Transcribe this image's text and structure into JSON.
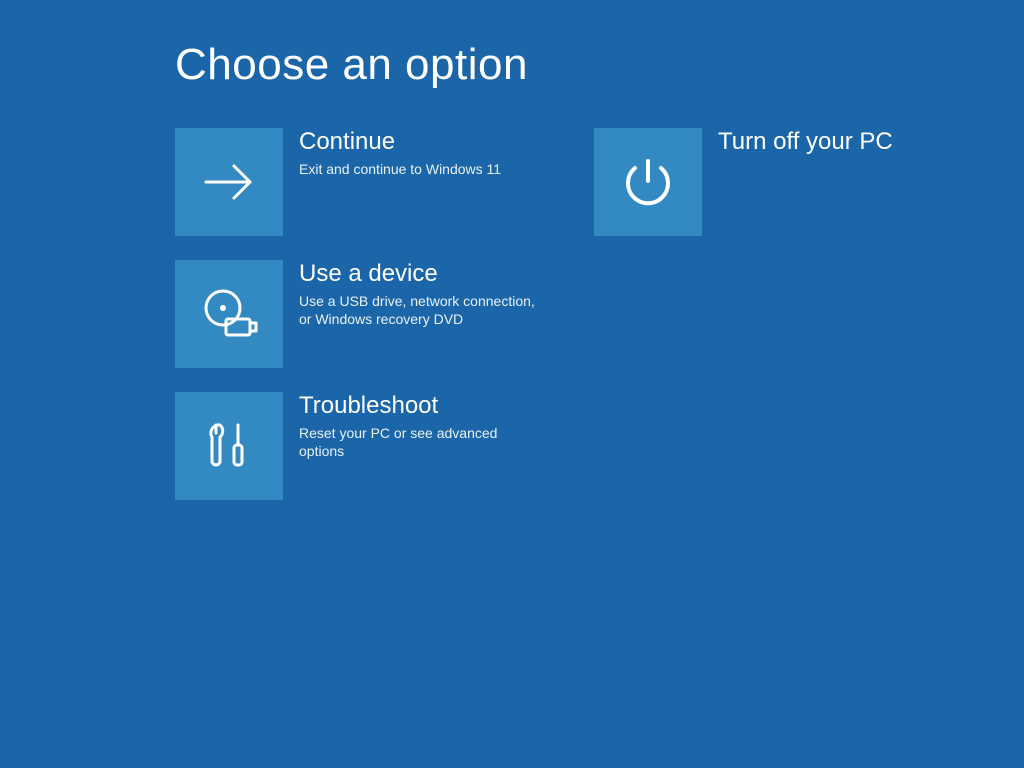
{
  "page": {
    "title": "Choose an option"
  },
  "options": {
    "continue": {
      "title": "Continue",
      "desc": "Exit and continue to Windows 11"
    },
    "use_device": {
      "title": "Use a device",
      "desc": "Use a USB drive, network connection, or Windows recovery DVD"
    },
    "troubleshoot": {
      "title": "Troubleshoot",
      "desc": "Reset your PC or see advanced options"
    },
    "turn_off": {
      "title": "Turn off your PC",
      "desc": ""
    }
  },
  "colors": {
    "background": "#1a66a8",
    "tile": "#338ac3",
    "text": "#ffffff"
  }
}
